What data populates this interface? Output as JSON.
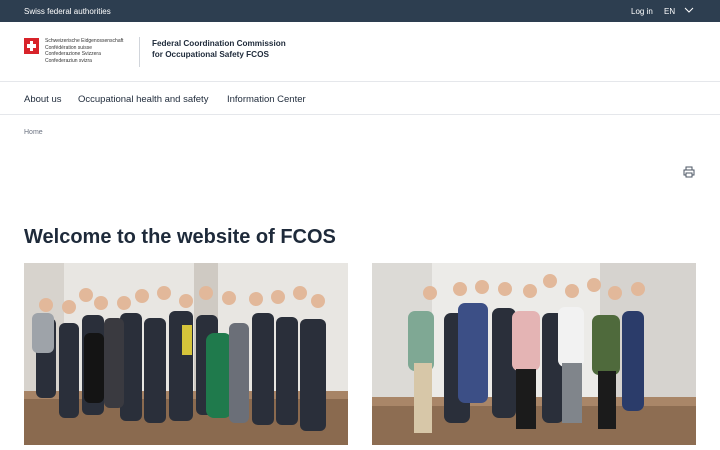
{
  "topbar": {
    "authorities": "Swiss federal authorities",
    "login": "Log in",
    "language": "EN",
    "background": "#2d3e50"
  },
  "logo": {
    "lines": [
      "Schweizerische Eidgenossenschaft",
      "Confédération suisse",
      "Confederazione Svizzera",
      "Confederaziun svizra"
    ],
    "flag_color": "#d8232a"
  },
  "org": {
    "name_line1": "Federal Coordination Commission",
    "name_line2": "for Occupational Safety FCOS"
  },
  "nav": {
    "items": [
      {
        "label": "About us"
      },
      {
        "label": "Occupational health and safety"
      },
      {
        "label": "Information Center"
      }
    ]
  },
  "breadcrumb": {
    "home": "Home"
  },
  "main": {
    "title": "Welcome to the website of FCOS",
    "print_icon": "printer-icon"
  }
}
